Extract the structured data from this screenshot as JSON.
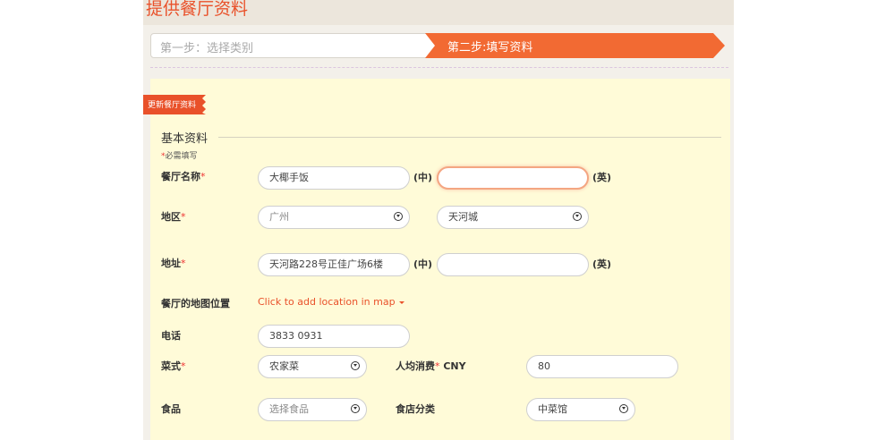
{
  "page": {
    "title": "提供餐厅资料"
  },
  "steps": [
    {
      "label": "第一步：选择类别"
    },
    {
      "label": "第二步:填写资料"
    }
  ],
  "ribbon": {
    "label": "更新餐厅资料"
  },
  "section": {
    "title": "基本资料",
    "required_note": "必需填写",
    "required_mark": "*"
  },
  "form": {
    "name": {
      "label": "餐厅名称",
      "zh_value": "大椰手饭",
      "en_value": "",
      "zh_suffix": "(中)",
      "en_suffix": "(英)"
    },
    "area": {
      "label": "地区",
      "city": "广州",
      "district": "天河城"
    },
    "address": {
      "label": "地址",
      "zh_value": "天河路228号正佳广场6楼",
      "en_value": "",
      "zh_suffix": "(中)",
      "en_suffix": "(英)"
    },
    "map": {
      "label": "餐厅的地图位置",
      "link": "Click to add location in map"
    },
    "phone": {
      "label": "电话",
      "value": "3833 0931"
    },
    "cuisine": {
      "label": "菜式",
      "value": "农家菜"
    },
    "avg_spend": {
      "label": "人均消费",
      "currency": "CNY",
      "value": "80"
    },
    "food": {
      "label": "食品",
      "placeholder": "选择食品"
    },
    "shop_type": {
      "label": "食店分类",
      "value": "中菜馆"
    }
  },
  "colors": {
    "accent": "#e9512a",
    "step_active": "#f26a33",
    "form_bg": "#fffbd8"
  },
  "icons": {
    "select_chevron": "chevron-down-circle-icon",
    "map_caret": "caret-down-icon"
  }
}
